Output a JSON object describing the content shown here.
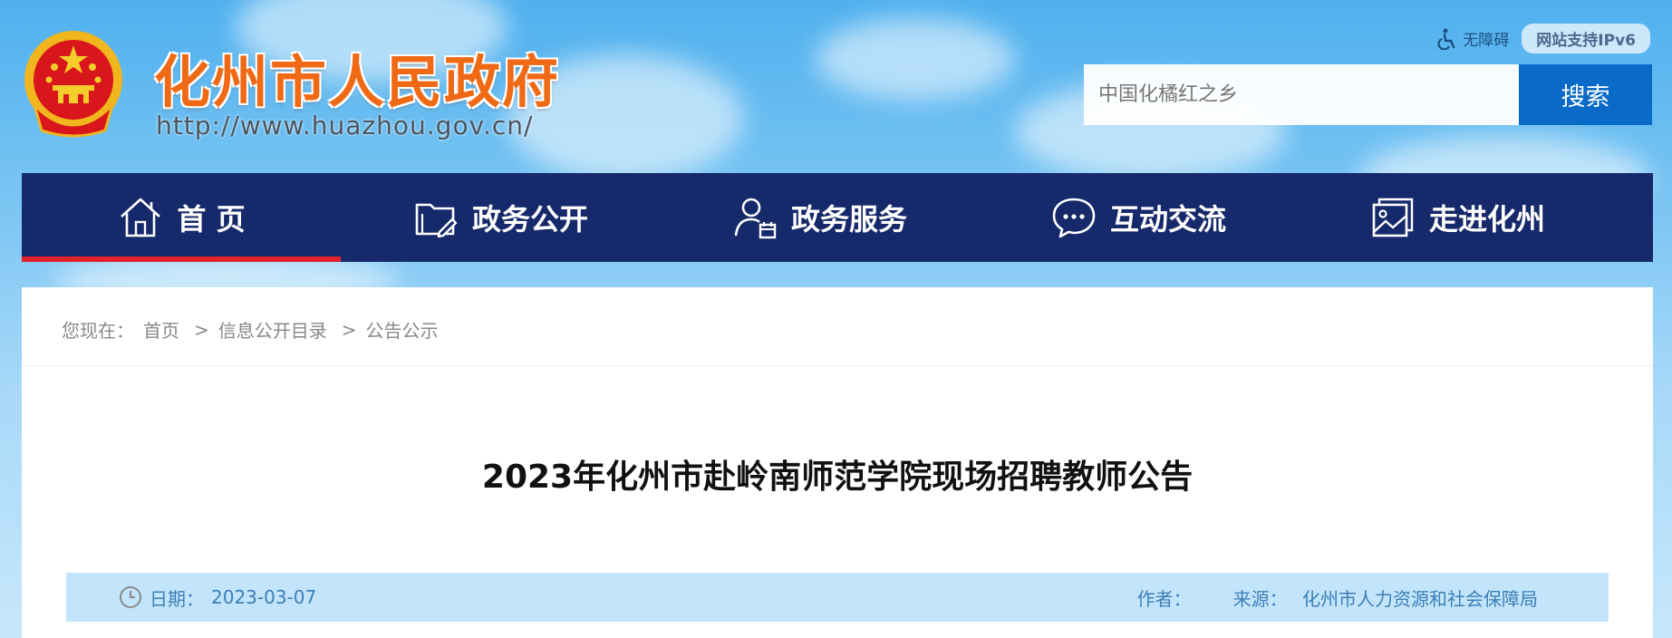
{
  "header": {
    "site_title": "化州市人民政府",
    "site_url": "http://www.huazhou.gov.cn/",
    "accessibility_label": "无障碍",
    "ipv6_label": "网站支持IPv6"
  },
  "search": {
    "placeholder": "中国化橘红之乡",
    "button_label": "搜索"
  },
  "nav": {
    "items": [
      {
        "label": "首 页",
        "icon": "home-icon",
        "active": true
      },
      {
        "label": "政务公开",
        "icon": "folder-edit-icon"
      },
      {
        "label": "政务服务",
        "icon": "user-calendar-icon"
      },
      {
        "label": "互动交流",
        "icon": "chat-bubble-icon"
      },
      {
        "label": "走进化州",
        "icon": "picture-icon"
      }
    ]
  },
  "breadcrumb": {
    "prefix": "您现在：",
    "items": [
      "首页",
      "信息公开目录",
      "公告公示"
    ],
    "separator": ">"
  },
  "article": {
    "title": "2023年化州市赴岭南师范学院现场招聘教师公告",
    "date_label": "日期：",
    "date": "2023-03-07",
    "author_label": "作者：",
    "author": "",
    "source_label": "来源：",
    "source": "化州市人力资源和社会保障局"
  },
  "colors": {
    "nav_bg": "#16296a",
    "nav_active_underline": "#e3212b",
    "search_button": "#0a6ac8",
    "title_orange": "#f06a16",
    "meta_bar": "#c3e5fb",
    "meta_text": "#3c7fb5"
  }
}
